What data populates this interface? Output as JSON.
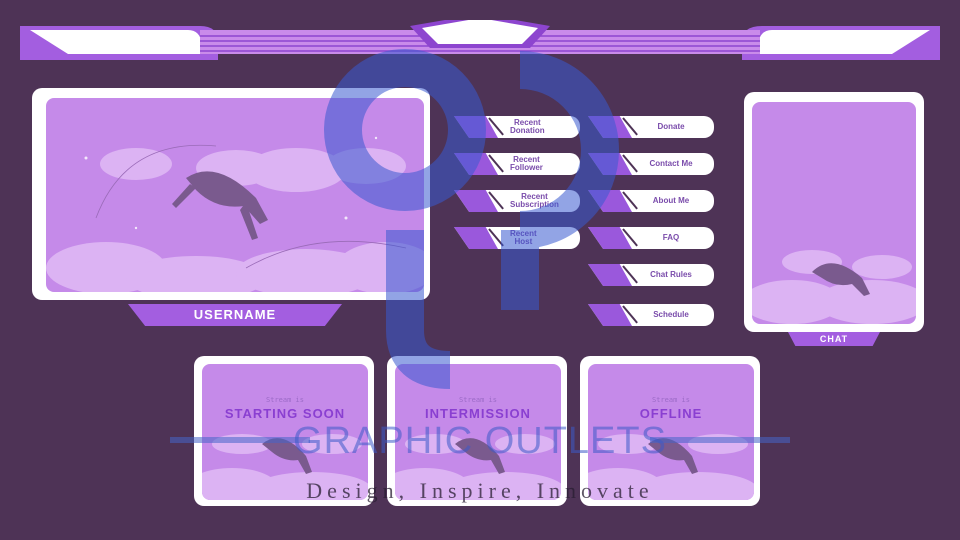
{
  "main_frame": {
    "label": "USERNAME"
  },
  "chat_frame": {
    "label": "CHAT"
  },
  "left_buttons": [
    {
      "label": "Recent\nDonation"
    },
    {
      "label": "Recent\nFollower"
    },
    {
      "label": "Recent\nSubscription"
    },
    {
      "label": "Recent\nHost"
    }
  ],
  "right_buttons": [
    {
      "label": "Donate"
    },
    {
      "label": "Contact Me"
    },
    {
      "label": "About Me"
    },
    {
      "label": "FAQ"
    },
    {
      "label": "Chat Rules"
    },
    {
      "label": "Schedule"
    }
  ],
  "scenes": [
    {
      "subtitle": "Stream is",
      "title": "STARTING SOON"
    },
    {
      "subtitle": "Stream is",
      "title": "INTERMISSION"
    },
    {
      "subtitle": "Stream is",
      "title": "OFFLINE"
    }
  ],
  "watermark": {
    "name": "GRAPHIC OUTLETS",
    "tagline": "Design, Inspire, Innovate"
  },
  "colors": {
    "background": "#4e3356",
    "accent": "#a35ee0",
    "panel_fill": "#c58ae9",
    "frame": "#ffffff"
  }
}
